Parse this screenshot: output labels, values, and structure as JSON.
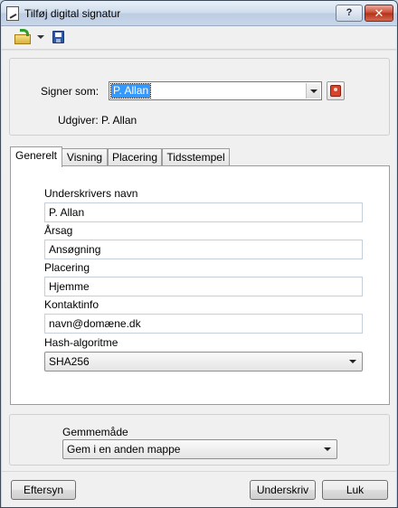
{
  "window": {
    "title": "Tilføj digital signatur"
  },
  "window_controls": {
    "help": "?",
    "close": "✕"
  },
  "toolbar": {
    "open_icon": "folder-open-icon",
    "save_icon": "floppy-save-icon"
  },
  "signer": {
    "label": "Signer som:",
    "value": "P. Allan",
    "publisher_label": "Udgiver: P. Allan"
  },
  "tabs": [
    "Generelt",
    "Visning",
    "Placering",
    "Tidsstempel"
  ],
  "general": {
    "signer_name_label": "Underskrivers navn",
    "signer_name_value": "P. Allan",
    "reason_label": "Årsag",
    "reason_value": "Ansøgning",
    "location_label": "Placering",
    "location_value": "Hjemme",
    "contact_label": "Kontaktinfo",
    "contact_value": "navn@domæne.dk",
    "hash_label": "Hash-algoritme",
    "hash_value": "SHA256"
  },
  "save_mode": {
    "label": "Gemmemåde",
    "value": "Gem i en anden mappe"
  },
  "buttons": {
    "preview": "Eftersyn",
    "sign": "Underskriv",
    "close": "Luk"
  }
}
